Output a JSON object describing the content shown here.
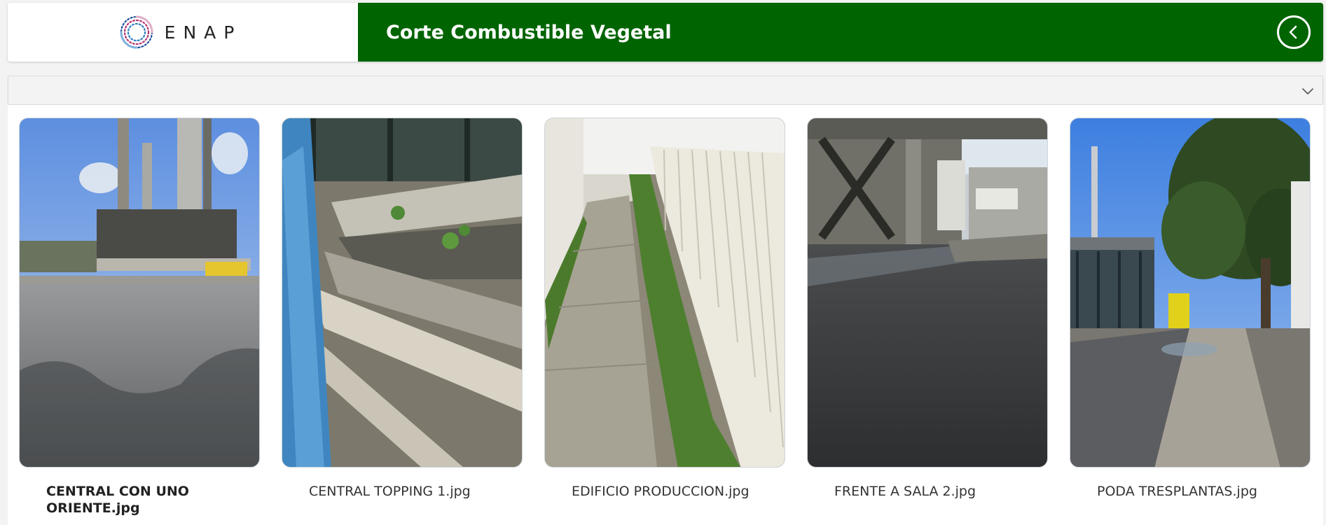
{
  "header": {
    "logo_text": "ENAP",
    "title": "Corte Combustible Vegetal",
    "back_icon": "chevron-left-circle-icon",
    "title_bar_color": "#006400"
  },
  "filter_bar": {
    "expand_icon": "chevron-down-icon"
  },
  "gallery": {
    "items": [
      {
        "caption": "CENTRAL CON UNO ORIENTE.jpg",
        "selected": true
      },
      {
        "caption": "CENTRAL TOPPING 1.jpg",
        "selected": false
      },
      {
        "caption": "EDIFICIO PRODUCCION.jpg",
        "selected": false
      },
      {
        "caption": "FRENTE A SALA 2.jpg",
        "selected": false
      },
      {
        "caption": "PODA TRESPLANTAS.jpg",
        "selected": false
      }
    ]
  }
}
